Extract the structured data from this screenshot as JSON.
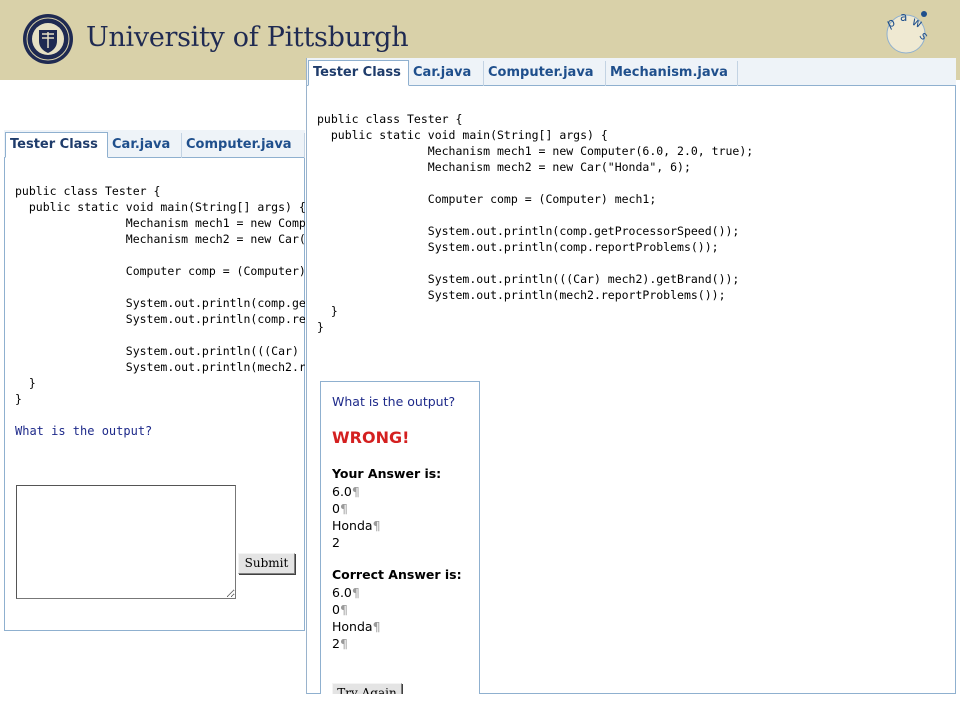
{
  "header": {
    "title": "University of Pittsburgh",
    "paws_logo_letters": "paws"
  },
  "back_window": {
    "tabs": [
      {
        "label": "Tester Class",
        "active": true
      },
      {
        "label": "Car.java",
        "active": false
      },
      {
        "label": "Computer.java",
        "active": false
      }
    ],
    "code_lines": [
      "public class Tester {",
      "  public static void main(String[] args) {",
      "                Mechanism mech1 = new Comp",
      "                Mechanism mech2 = new Car(",
      "",
      "                Computer comp = (Computer)",
      "",
      "                System.out.println(comp.ge",
      "                System.out.println(comp.re",
      "",
      "                System.out.println(((Car) ",
      "                System.out.println(mech2.r",
      "  }",
      "}"
    ],
    "question": "What is the output?",
    "answer_value": "",
    "submit_label": "Submit"
  },
  "front_window": {
    "tabs": [
      {
        "label": "Tester Class",
        "active": true
      },
      {
        "label": "Car.java",
        "active": false
      },
      {
        "label": "Computer.java",
        "active": false
      },
      {
        "label": "Mechanism.java",
        "active": false
      }
    ],
    "code_lines": [
      "public class Tester {",
      "  public static void main(String[] args) {",
      "                Mechanism mech1 = new Computer(6.0, 2.0, true);",
      "                Mechanism mech2 = new Car(\"Honda\", 6);",
      "",
      "                Computer comp = (Computer) mech1;",
      "",
      "                System.out.println(comp.getProcessorSpeed());",
      "                System.out.println(comp.reportProblems());",
      "",
      "                System.out.println(((Car) mech2).getBrand());",
      "                System.out.println(mech2.reportProblems());",
      "  }",
      "}"
    ],
    "feedback": {
      "question": "What is the output?",
      "verdict": "WRONG!",
      "your_answer_label": "Your Answer is:",
      "your_answer_lines": [
        "6.0",
        "0",
        "Honda",
        "2"
      ],
      "correct_answer_label": "Correct Answer is:",
      "correct_answer_lines": [
        "6.0",
        "0",
        "Honda",
        "2"
      ],
      "pilcrow": "¶",
      "try_again_label": "Try Again"
    }
  },
  "colors": {
    "banner": "#d9d1a9",
    "title": "#1f2a52",
    "tab_text": "#1f4f8c",
    "border": "#8fb0cf",
    "question_text": "#1e2a8a",
    "wrong": "#d42020"
  }
}
